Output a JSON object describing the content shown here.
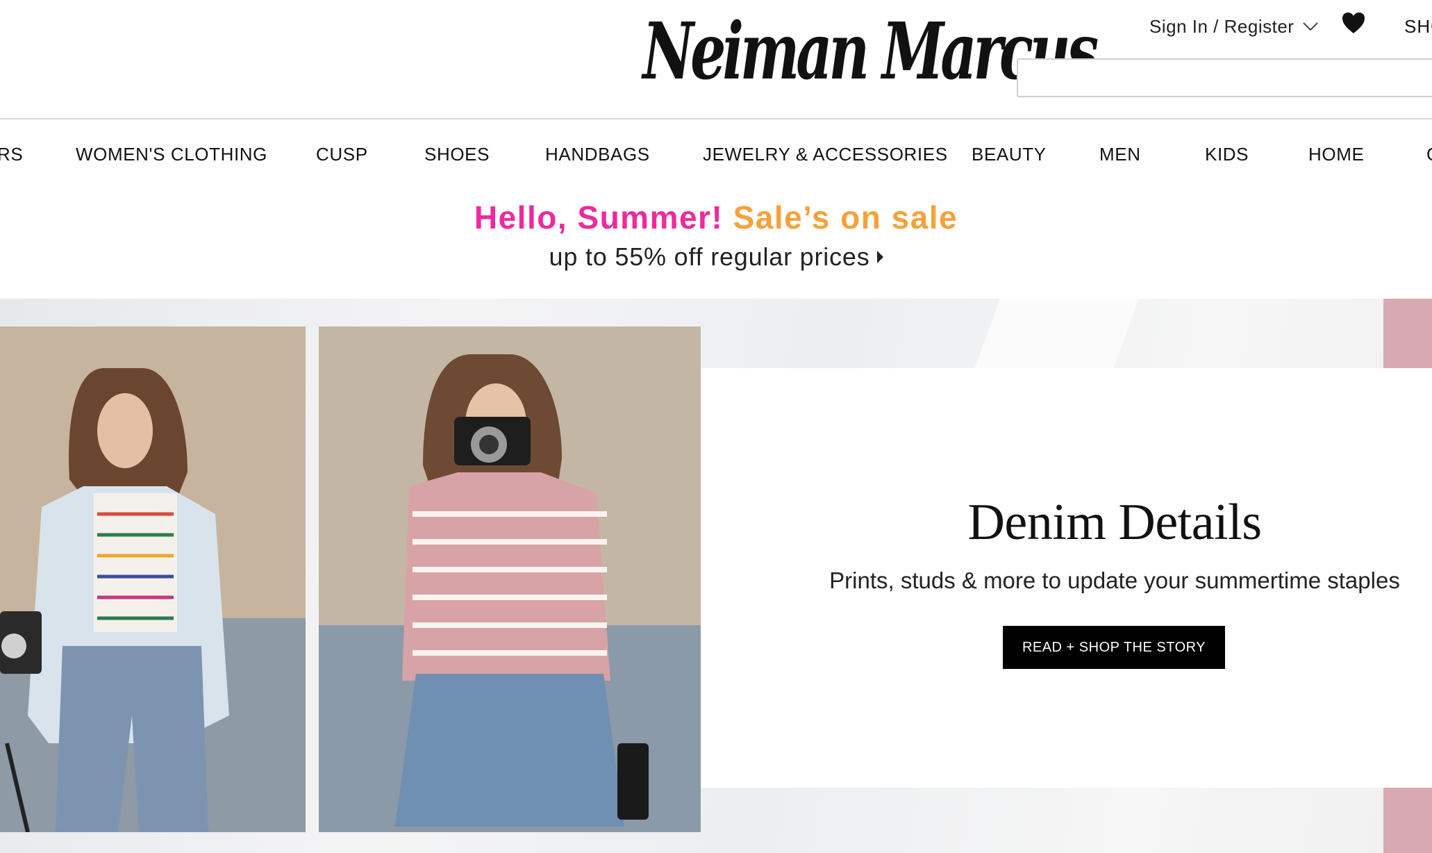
{
  "header": {
    "logo_text": "Neiman Marcus",
    "account_label": "Sign In / Register",
    "shop_label": "SHO",
    "search_placeholder": ""
  },
  "nav": {
    "items": [
      {
        "label": "RS"
      },
      {
        "label": "WOMEN'S CLOTHING"
      },
      {
        "label": "CUSP"
      },
      {
        "label": "SHOES"
      },
      {
        "label": "HANDBAGS"
      },
      {
        "label": "JEWELRY & ACCESSORIES"
      },
      {
        "label": "BEAUTY"
      },
      {
        "label": "MEN"
      },
      {
        "label": "KIDS"
      },
      {
        "label": "HOME"
      },
      {
        "label": "G"
      }
    ]
  },
  "promo": {
    "headline_part1": "Hello, Summer!",
    "headline_part2": "Sale’s on sale",
    "subline": "up to 55% off regular prices",
    "colors": {
      "pink": "#ee2a9e",
      "orange": "#f7a13a"
    }
  },
  "hero": {
    "title": "Denim Details",
    "subtitle": "Prints, studs & more to update your summertime staples",
    "cta_label": "READ + SHOP THE STORY"
  },
  "icons": {
    "account_menu": "chevron-down-icon",
    "wishlist": "heart-icon",
    "promo_arrow": "caret-right-icon"
  }
}
